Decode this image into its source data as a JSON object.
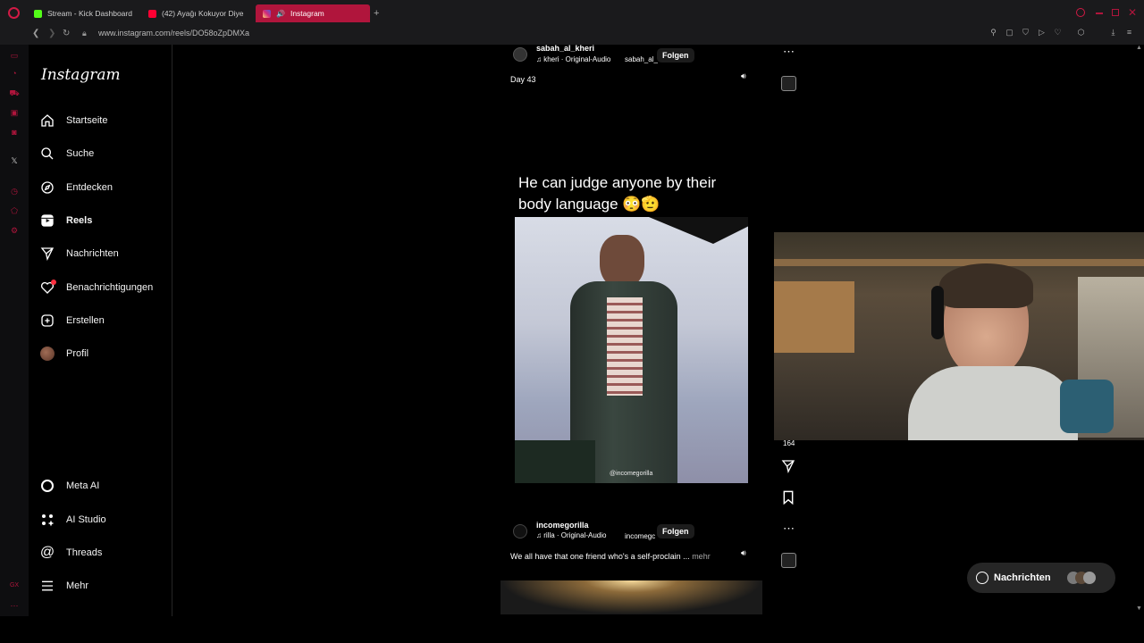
{
  "browser": {
    "tabs": [
      {
        "label": "Stream - Kick Dashboard",
        "icon": "kick-icon",
        "color": "#53fc18"
      },
      {
        "label": "(42) Ayağı Kokuyor Diye",
        "icon": "youtube-icon",
        "color": "#ff0033"
      },
      {
        "label": "Instagram",
        "icon": "instagram-icon",
        "color": "#e1306c",
        "active": true
      }
    ],
    "new_tab_label": "+",
    "url": "www.instagram.com/reels/DO58oZpDMXa"
  },
  "sidebar": {
    "logo": "Instagram",
    "items": [
      {
        "label": "Startseite",
        "icon": "home-icon"
      },
      {
        "label": "Suche",
        "icon": "search-icon"
      },
      {
        "label": "Entdecken",
        "icon": "compass-icon"
      },
      {
        "label": "Reels",
        "icon": "reels-icon",
        "active": true
      },
      {
        "label": "Nachrichten",
        "icon": "paper-plane-icon"
      },
      {
        "label": "Benachrichtigungen",
        "icon": "heart-icon"
      },
      {
        "label": "Erstellen",
        "icon": "plus-square-icon"
      },
      {
        "label": "Profil",
        "icon": "avatar"
      }
    ],
    "bottom_items": [
      {
        "label": "Meta AI",
        "icon": "meta-ai-icon"
      },
      {
        "label": "AI Studio",
        "icon": "ai-studio-icon"
      },
      {
        "label": "Threads",
        "icon": "threads-icon"
      },
      {
        "label": "Mehr",
        "icon": "menu-icon"
      }
    ]
  },
  "reel1": {
    "username": "sabah_al_kheri",
    "audio": "kheri · Original-Audio",
    "audio_extra": "sabah_al_",
    "follow": "Folgen",
    "caption": "Day 43"
  },
  "reel2": {
    "overlay_text": "He can judge anyone by their body language 😳🫡",
    "watermark": "@incomegorilla",
    "like_count": "164",
    "username": "incomegorilla",
    "audio": "rilla · Original-Audio",
    "audio_extra": "incomegc",
    "follow": "Folgen",
    "caption": "We all have that one friend who's a self-proclain ...",
    "more": "mehr"
  },
  "messages_pill": {
    "label": "Nachrichten"
  },
  "colors": {
    "accent": "#b0153c",
    "background": "#000000",
    "notification_dot": "#ff3040"
  }
}
